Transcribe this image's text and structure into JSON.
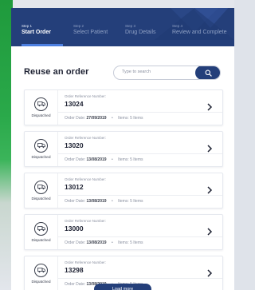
{
  "steps": [
    {
      "num": "Step 1",
      "label": "Start Order",
      "active": true
    },
    {
      "num": "Step 2",
      "label": "Select Patient",
      "active": false
    },
    {
      "num": "Step 3",
      "label": "Drug Details",
      "active": false
    },
    {
      "num": "Step 4",
      "label": "Review and Complete",
      "active": false
    }
  ],
  "page": {
    "title": "Reuse an order"
  },
  "search": {
    "placeholder": "Type to search",
    "button_icon": "search-icon"
  },
  "orders": [
    {
      "status": "Dispatched",
      "ref_label": "Order Reference Number:",
      "ref": "13024",
      "date_label": "Order Date:",
      "date": "27/09/2019",
      "items": "Items: 5 Items"
    },
    {
      "status": "Dispatched",
      "ref_label": "Order Reference Number:",
      "ref": "13020",
      "date_label": "Order Date:",
      "date": "13/08/2019",
      "items": "Items: 5 Items"
    },
    {
      "status": "Dispatched",
      "ref_label": "Order Reference Number:",
      "ref": "13012",
      "date_label": "Order Date:",
      "date": "13/08/2019",
      "items": "Items: 5 Items"
    },
    {
      "status": "Dispatched",
      "ref_label": "Order Reference Number:",
      "ref": "13000",
      "date_label": "Order Date:",
      "date": "13/08/2019",
      "items": "Items: 5 Items"
    },
    {
      "status": "Dispatched",
      "ref_label": "Order Reference Number:",
      "ref": "13298",
      "date_label": "Order Date:",
      "date": "13/08/2019",
      "items": "Items: 5 Items"
    }
  ],
  "load_more": "Load more",
  "colors": {
    "primary": "#243f7a",
    "accent": "#4c7fe0",
    "brand_green": "#2aa94a"
  }
}
